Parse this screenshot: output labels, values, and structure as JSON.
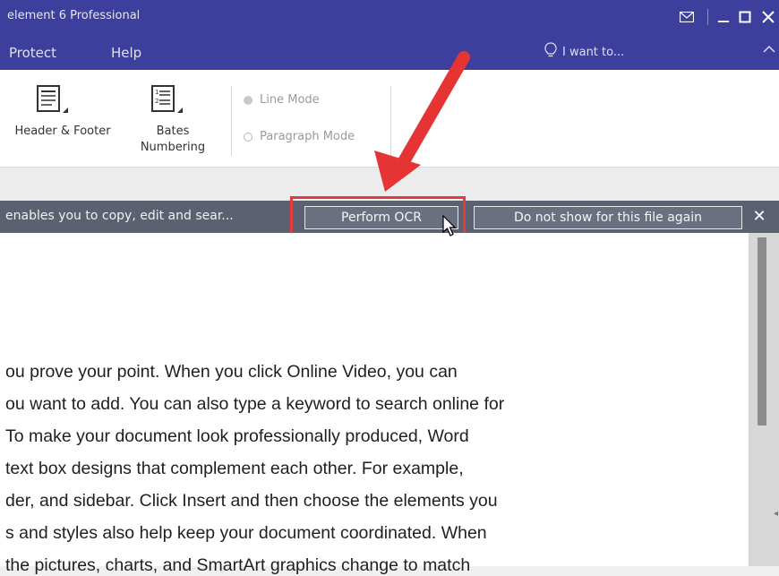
{
  "window": {
    "title": "element 6 Professional"
  },
  "menu": {
    "protect": "Protect",
    "help": "Help",
    "i_want_to": "I want to..."
  },
  "ribbon": {
    "header_footer": "Header & Footer",
    "bates_line1": "Bates",
    "bates_line2": "Numbering",
    "line_mode": "Line Mode",
    "paragraph_mode": "Paragraph Mode"
  },
  "ocr_bar": {
    "message": "enables you to copy, edit and sear...",
    "perform_button": "Perform OCR",
    "dont_show_button": "Do not show for this file again",
    "close": "✕"
  },
  "document": {
    "lines": [
      "ou prove your point. When you click Online Video, you can",
      "ou want to add. You can also type a keyword to search online for",
      "To make your document look professionally produced, Word",
      " text box designs that complement each other. For example,",
      "der, and sidebar. Click Insert and then choose the elements you",
      "s and styles also help keep your document coordinated. When",
      "    the pictures, charts, and SmartArt graphics change to match"
    ]
  },
  "colors": {
    "titlebar": "#3c3f9b",
    "ocr_bar": "#5b6170",
    "annotation_red": "#e33a3a"
  },
  "icons": {
    "mail": "mail-icon",
    "minimize": "minimize-icon",
    "maximize": "maximize-icon",
    "close": "close-icon",
    "lightbulb": "lightbulb-icon",
    "collapse": "chevron-up-icon",
    "header_footer": "header-footer-icon",
    "bates": "bates-numbering-icon"
  }
}
